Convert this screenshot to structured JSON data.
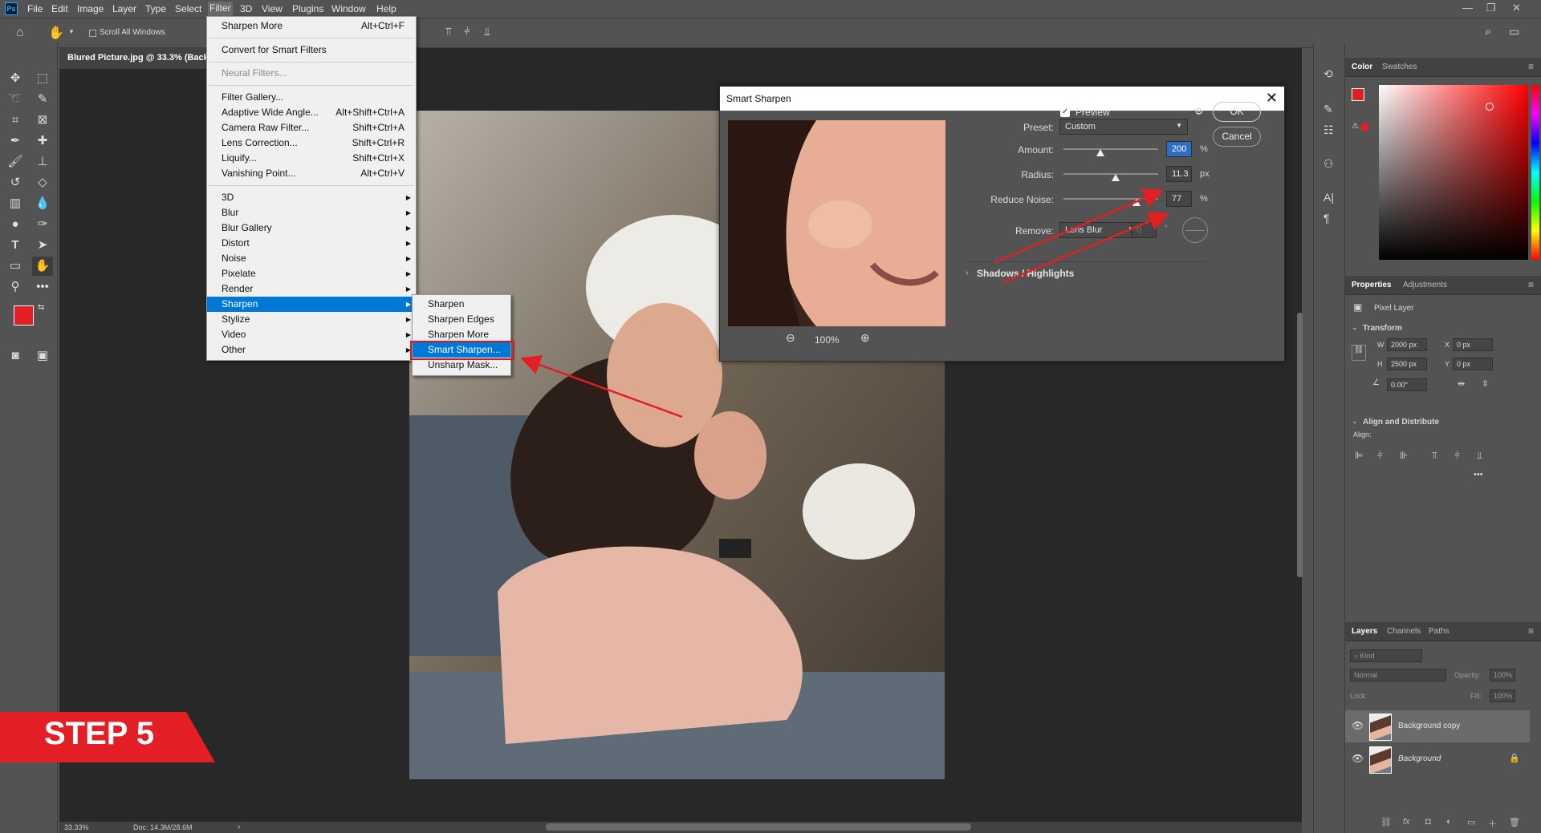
{
  "app": {
    "logo": "Ps",
    "menu": [
      "File",
      "Edit",
      "Image",
      "Layer",
      "Type",
      "Select",
      "Filter",
      "3D",
      "View",
      "Plugins",
      "Window",
      "Help"
    ]
  },
  "options": {
    "scroll_all_windows": "Scroll All Windows"
  },
  "document": {
    "tab_title": "Blured Picture.jpg @ 33.3% (Back",
    "zoom": "33.33%",
    "doc_size": "Doc: 14.3M/28.6M"
  },
  "filter_menu": {
    "last_filter": {
      "label": "Sharpen More",
      "shortcut": "Alt+Ctrl+F"
    },
    "convert": "Convert for Smart Filters",
    "neural": "Neural Filters...",
    "items": [
      {
        "label": "Filter Gallery...",
        "shortcut": ""
      },
      {
        "label": "Adaptive Wide Angle...",
        "shortcut": "Alt+Shift+Ctrl+A"
      },
      {
        "label": "Camera Raw Filter...",
        "shortcut": "Shift+Ctrl+A"
      },
      {
        "label": "Lens Correction...",
        "shortcut": "Shift+Ctrl+R"
      },
      {
        "label": "Liquify...",
        "shortcut": "Shift+Ctrl+X"
      },
      {
        "label": "Vanishing Point...",
        "shortcut": "Alt+Ctrl+V"
      }
    ],
    "groups": [
      "3D",
      "Blur",
      "Blur Gallery",
      "Distort",
      "Noise",
      "Pixelate",
      "Render",
      "Sharpen",
      "Stylize",
      "Video",
      "Other"
    ],
    "highlighted_group": "Sharpen"
  },
  "sharpen_submenu": [
    "Sharpen",
    "Sharpen Edges",
    "Sharpen More",
    "Smart Sharpen...",
    "Unsharp Mask..."
  ],
  "dialog": {
    "title": "Smart Sharpen",
    "preview_label": "Preview",
    "preview_checked": true,
    "zoom_level": "100%",
    "preset_label": "Preset:",
    "preset_value": "Custom",
    "amount_label": "Amount:",
    "amount": "200",
    "amount_unit": "%",
    "amount_fraction": 0.39,
    "radius_label": "Radius:",
    "radius": "11.3",
    "radius_unit": "px",
    "radius_fraction": 0.55,
    "noise_label": "Reduce Noise:",
    "noise": "77",
    "noise_unit": "%",
    "noise_fraction": 0.77,
    "remove_label": "Remove:",
    "remove_value": "Lens Blur",
    "angle_value": "0",
    "angle_unit": "°",
    "shadows_highlights": "Shadows / Highlights",
    "ok": "OK",
    "cancel": "Cancel"
  },
  "panels": {
    "color_tabs": [
      "Color",
      "Swatches"
    ],
    "foreground_color": "#e31e24",
    "properties_tabs": [
      "Properties",
      "Adjustments"
    ],
    "layer_type": "Pixel Layer",
    "transform_label": "Transform",
    "w_label": "W",
    "w_value": "2000 px",
    "h_label": "H",
    "h_value": "2500 px",
    "x_label": "X",
    "x_value": "0 px",
    "y_label": "Y",
    "y_value": "0 px",
    "angle": "0.00°",
    "align_title": "Align and Distribute",
    "align_label": "Align:",
    "layers_tabs": [
      "Layers",
      "Channels",
      "Paths"
    ],
    "kind_placeholder": "Kind",
    "blend_mode": "Normal",
    "opacity_label": "Opacity:",
    "opacity_value": "100%",
    "lock_label": "Lock:",
    "fill_label": "Fill:",
    "fill_value": "100%",
    "layers": [
      "Background copy",
      "Background"
    ]
  },
  "banner": {
    "text": "STEP 5",
    "color": "#e31e24"
  }
}
